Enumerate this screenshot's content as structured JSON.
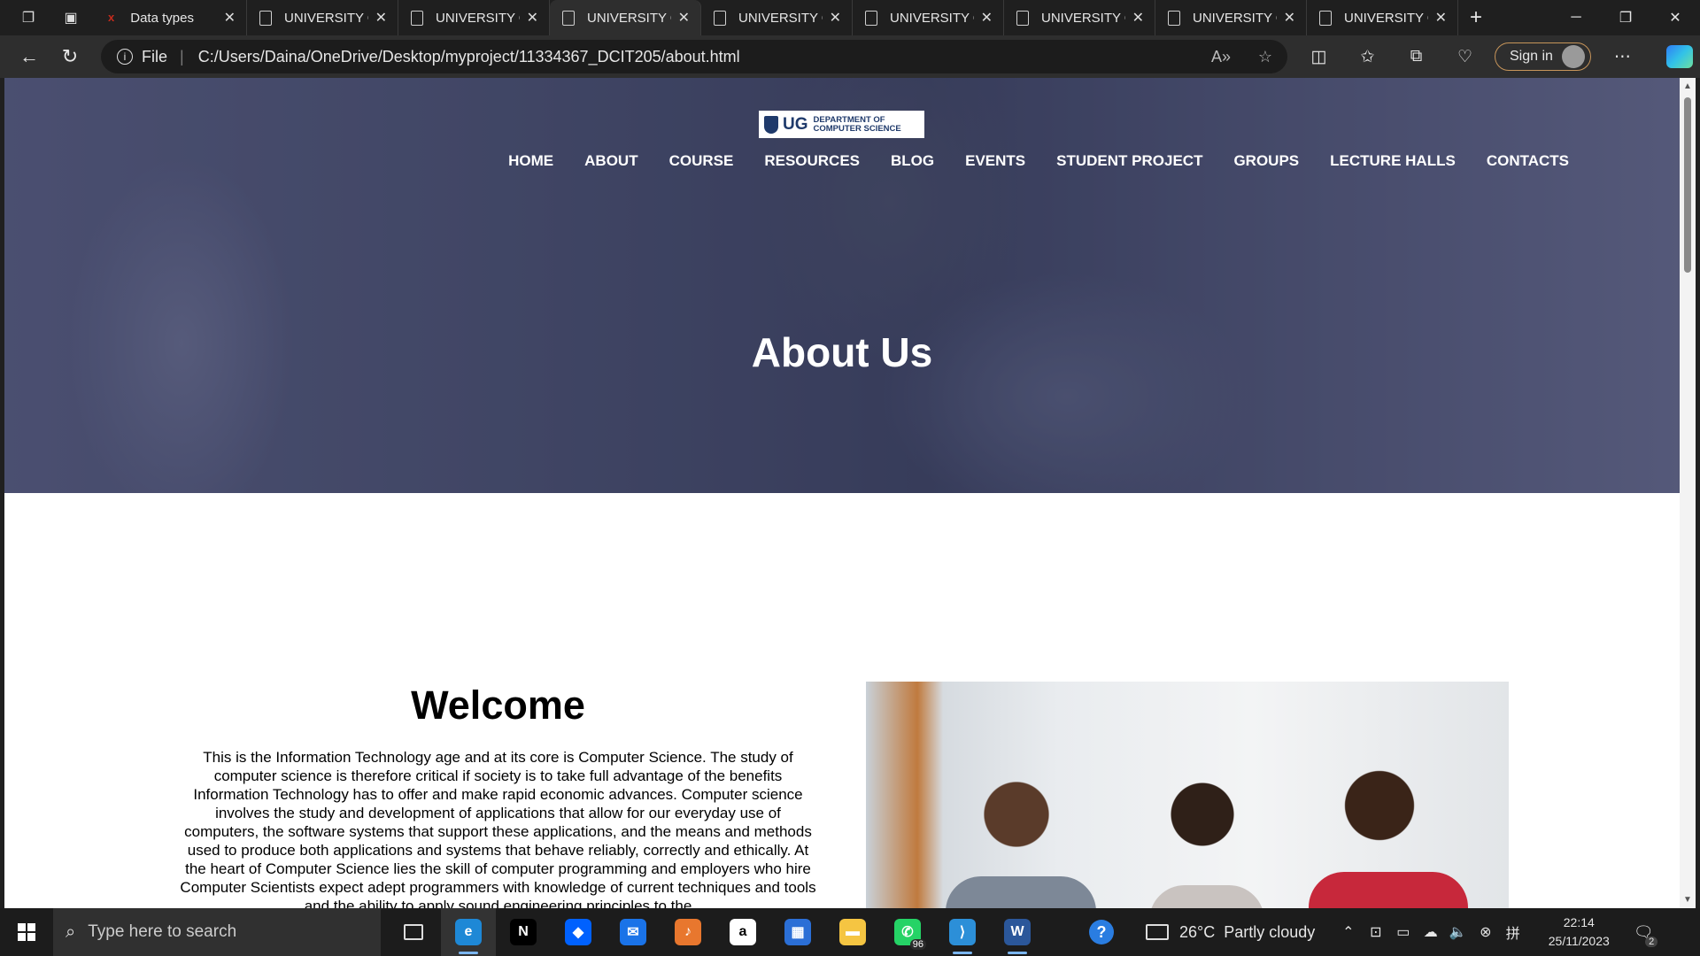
{
  "browser": {
    "tabs": [
      {
        "title": "Data types",
        "favicon": "red-x",
        "active": false
      },
      {
        "title": "UNIVERSITY OF GHANA",
        "favicon": "page-icon",
        "active": false
      },
      {
        "title": "UNIVERSITY OF GHANA",
        "favicon": "page-icon",
        "active": false
      },
      {
        "title": "UNIVERSITY OF GHANA",
        "favicon": "page-icon",
        "active": true
      },
      {
        "title": "UNIVERSITY OF GHANA",
        "favicon": "page-icon",
        "active": false
      },
      {
        "title": "UNIVERSITY OF GHANA",
        "favicon": "page-icon",
        "active": false
      },
      {
        "title": "UNIVERSITY OF GHANA",
        "favicon": "page-icon",
        "active": false
      },
      {
        "title": "UNIVERSITY OF GHANA",
        "favicon": "page-icon",
        "active": false
      },
      {
        "title": "UNIVERSITY OF GHANA",
        "favicon": "page-icon",
        "active": false
      }
    ],
    "address": {
      "scheme_label": "File",
      "url": "C:/Users/Daina/OneDrive/Desktop/myproject/11334367_DCIT205/about.html"
    },
    "sign_in_label": "Sign in"
  },
  "page": {
    "logo": {
      "short": "UG",
      "line1": "DEPARTMENT OF",
      "line2": "COMPUTER SCIENCE"
    },
    "nav": [
      "HOME",
      "ABOUT",
      "COURSE",
      "RESOURCES",
      "BLOG",
      "EVENTS",
      "STUDENT PROJECT",
      "GROUPS",
      "LECTURE HALLS",
      "CONTACTS"
    ],
    "hero_title": "About Us",
    "welcome": {
      "heading": "Welcome",
      "body": "This is the Information Technology age and at its core is Computer Science. The study of computer science is therefore critical if society is to take full advantage of the benefits Information Technology has to offer and make rapid economic advances. Computer science involves the study and development of applications that allow for our everyday use of computers, the software systems that support these applications, and the means and methods used to produce both applications and systems that behave reliably, correctly and ethically. At the heart of Computer Science lies the skill of computer programming and employers who hire Computer Scientists expect adept programmers with knowledge of current techniques and tools and the ability to apply sound engineering principles to the"
    }
  },
  "taskbar": {
    "search_placeholder": "Type here to search",
    "apps": [
      {
        "name": "task-view",
        "label": "",
        "color": "#1c1c1c",
        "active": false
      },
      {
        "name": "edge",
        "label": "e",
        "color": "#1e88d6",
        "active": true
      },
      {
        "name": "netflix",
        "label": "N",
        "color": "#000000",
        "active": false
      },
      {
        "name": "dropbox",
        "label": "◆",
        "color": "#0061fe",
        "active": false
      },
      {
        "name": "mail",
        "label": "✉",
        "color": "#1a73e8",
        "active": false
      },
      {
        "name": "fl-studio",
        "label": "♪",
        "color": "#e8772e",
        "active": false
      },
      {
        "name": "amazon",
        "label": "a",
        "color": "#ffffff",
        "active": false
      },
      {
        "name": "store",
        "label": "▦",
        "color": "#2b6fd6",
        "active": false
      },
      {
        "name": "file-explorer",
        "label": "▬",
        "color": "#f5c542",
        "active": false
      },
      {
        "name": "whatsapp",
        "label": "✆",
        "color": "#25d366",
        "active": false,
        "badge": "96"
      },
      {
        "name": "vscode",
        "label": "⟩",
        "color": "#2c8fd8",
        "active": true
      },
      {
        "name": "word",
        "label": "W",
        "color": "#2b579a",
        "active": true
      }
    ],
    "weather": {
      "temp": "26°C",
      "desc": "Partly cloudy"
    },
    "time": "22:14",
    "date": "25/11/2023",
    "notifications": "2"
  }
}
